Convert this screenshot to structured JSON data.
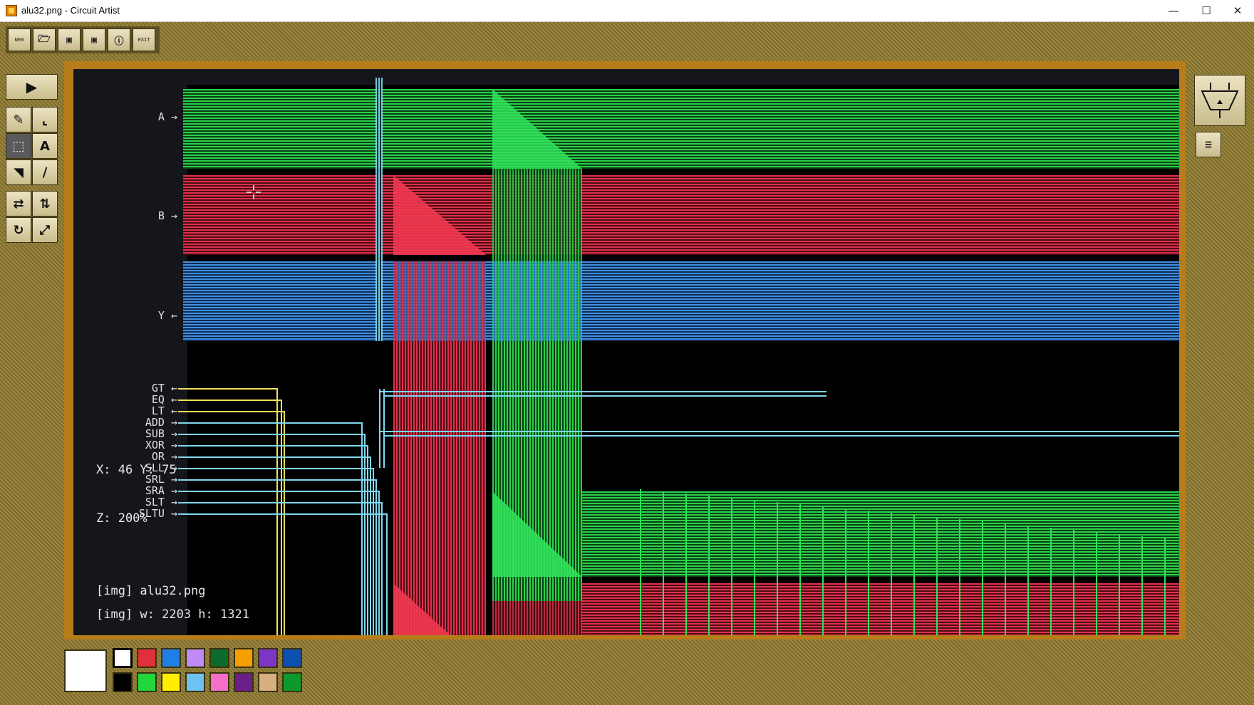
{
  "window": {
    "title": "alu32.png - Circuit Artist",
    "minimize_glyph": "—",
    "maximize_glyph": "☐",
    "close_glyph": "✕"
  },
  "toolbar": {
    "buttons": [
      {
        "name": "new-button",
        "icon": "new-icon",
        "glyph": "NEW"
      },
      {
        "name": "open-button",
        "icon": "folder-icon",
        "glyph": "📂"
      },
      {
        "name": "save-button",
        "icon": "floppy-icon",
        "glyph": "💾"
      },
      {
        "name": "save-as-button",
        "icon": "floppy-plus-icon",
        "glyph": "💾"
      },
      {
        "name": "info-button",
        "icon": "info-icon",
        "glyph": "ⓘ"
      },
      {
        "name": "exit-button",
        "icon": "exit-icon",
        "glyph": "EXIT"
      }
    ]
  },
  "tools": {
    "run_glyph": "▶",
    "items": [
      {
        "name": "pencil-tool",
        "icon": "pencil-icon",
        "glyph": "✎"
      },
      {
        "name": "line-tool",
        "icon": "line-icon",
        "glyph": "⌞"
      },
      {
        "name": "select-tool",
        "icon": "selection-icon",
        "glyph": "⬚"
      },
      {
        "name": "text-tool",
        "icon": "text-icon",
        "glyph": "A"
      },
      {
        "name": "fill-tool",
        "icon": "bucket-icon",
        "glyph": "◥"
      },
      {
        "name": "picker-tool",
        "icon": "eyedropper-icon",
        "glyph": "∕"
      }
    ],
    "transform": [
      {
        "name": "flip-h-tool",
        "icon": "flip-horizontal-icon",
        "glyph": "⇄"
      },
      {
        "name": "flip-v-tool",
        "icon": "flip-vertical-icon",
        "glyph": "⇅"
      },
      {
        "name": "rotate-tool",
        "icon": "rotate-icon",
        "glyph": "↻"
      },
      {
        "name": "resize-tool",
        "icon": "resize-icon",
        "glyph": "⤢"
      }
    ]
  },
  "pins": {
    "inputs_bus": [
      "A",
      "B"
    ],
    "output_bus": "Y",
    "ctrl": [
      "GT",
      "EQ",
      "LT",
      "ADD",
      "SUB",
      "XOR",
      "OR",
      "SLL",
      "SRL",
      "SRA",
      "SLT",
      "SLTU"
    ]
  },
  "overlay": {
    "coord_x": "X: 46 Y: 75",
    "coord_z": "Z: 200%",
    "img_name": "[img] alu32.png",
    "img_size": "[img] w: 2203 h: 1321"
  },
  "palette": {
    "current": "#ffffff",
    "colors": [
      "#ffffff",
      "#e0303a",
      "#1f7fe6",
      "#c28af5",
      "#0c6b2a",
      "#f5a000",
      "#7d35c8",
      "#0d4fb0",
      "#000000",
      "#22d63c",
      "#ffee00",
      "#6cc2f0",
      "#f56ec8",
      "#6a1f8a",
      "#d7b07f",
      "#0c9a2c"
    ]
  }
}
